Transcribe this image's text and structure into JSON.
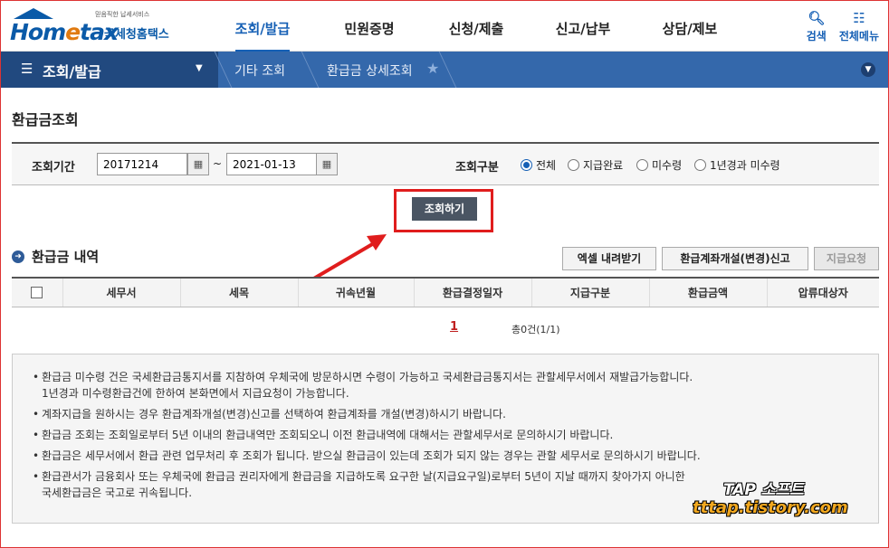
{
  "header": {
    "logo_small": "믿음직한 납세서비스",
    "logo_brand_a": "Hom",
    "logo_brand_e": "e",
    "logo_brand_b": "tax",
    "logo_kr": "국세청홈택스",
    "menu": [
      "조회/발급",
      "민원증명",
      "신청/제출",
      "신고/납부",
      "상담/제보"
    ],
    "search_label": "검색",
    "allmenu_label": "전체메뉴"
  },
  "navbar": {
    "current": "조회/발급",
    "crumb1": "기타 조회",
    "crumb2": "환급금 상세조회"
  },
  "page": {
    "title": "환급금조회"
  },
  "search": {
    "period_label": "조회기간",
    "start_date": "20171214",
    "end_date": "2021-01-13",
    "tilde": "~",
    "type_label": "조회구분",
    "options": [
      "전체",
      "지급완료",
      "미수령",
      "1년경과 미수령"
    ],
    "selected": "전체",
    "button": "조회하기"
  },
  "list": {
    "title": "환급금 내역",
    "buttons": [
      "엑셀 내려받기",
      "환급계좌개설(변경)신고",
      "지급요청"
    ],
    "columns": [
      "세무서",
      "세목",
      "귀속년월",
      "환급결정일자",
      "지급구분",
      "환급금액",
      "압류대상자"
    ],
    "page": "1",
    "total": "총0건(1/1)"
  },
  "notes": [
    "환급금 미수령 건은 국세환급금통지서를 지참하여 우체국에 방문하시면 수령이 가능하고 국세환급금통지서는 관할세무서에서 재발급가능합니다.\n1년경과 미수령환급건에 한하여 본화면에서 지급요청이 가능합니다.",
    "계좌지급을 원하시는 경우 환급계좌개설(변경)신고를 선택하여 환급계좌를 개설(변경)하시기 바랍니다.",
    "환급금 조회는 조회일로부터 5년 이내의 환급내역만 조회되오니 이전 환급내역에 대해서는 관할세무서로 문의하시기 바랍니다.",
    "환급금은 세무서에서 환급 관련 업무처리 후 조회가 됩니다. 받으실 환급금이 있는데 조회가 되지 않는 경우는 관할 세무서로 문의하시기 바랍니다.",
    "환급관서가 금융회사 또는 우체국에 환급금 권리자에게 환급금을 지급하도록 요구한 날(지급요구일)로부터 5년이 지날 때까지 찾아가지 아니한\n국세환급금은 국고로 귀속됩니다."
  ],
  "watermark": {
    "line1": "TAP 소프트",
    "line2": "tttap.tistory.com"
  },
  "colors": {
    "accent": "#1660b5",
    "highlight": "#e01d1d"
  }
}
